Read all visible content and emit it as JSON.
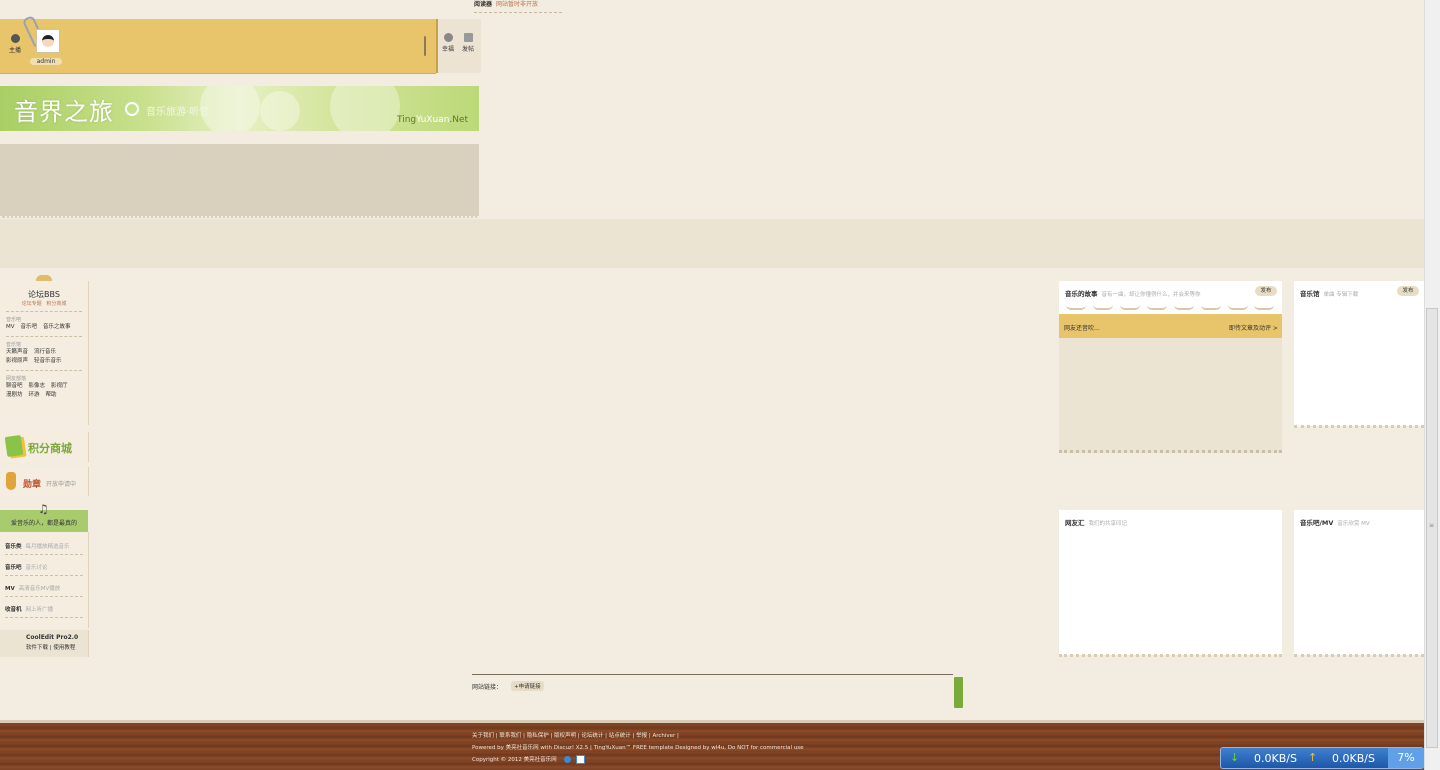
{
  "notice": {
    "label": "阅读器",
    "text": "网站暂时非开放"
  },
  "userbar": {
    "left_btn": "主播",
    "username": "admin",
    "right_btn1": "幸福",
    "right_btn2": "发帖"
  },
  "banner": {
    "title": "音界之旅",
    "subtitle": "音乐旅游·听音",
    "site_prefix": "Ting",
    "site_bold": "YuXuan",
    "site_suffix": ".Net"
  },
  "sidebar": {
    "forum": {
      "title": "论坛BBS",
      "sub1": "论坛专题",
      "sub2": "积分商城",
      "groups": [
        {
          "head": "音乐吧",
          "rows": [
            [
              "MV",
              "音乐吧",
              "音乐之故事"
            ]
          ]
        },
        {
          "head": "音乐馆",
          "rows": [
            [
              "天籁声音",
              "流行音乐"
            ],
            [
              "影视原声",
              "轻音乐音乐"
            ]
          ]
        },
        {
          "head": "网友部落",
          "rows": [
            [
              "聊音吧",
              "影像志",
              "影视厅"
            ],
            [
              "漫剧坊",
              "环游",
              "帮助"
            ]
          ]
        }
      ]
    },
    "shop": {
      "label": "积分商城"
    },
    "medal": {
      "label": "勋章",
      "sub": "开放申请中"
    },
    "music": {
      "title": "爱音乐的人，都是最真的",
      "items": [
        {
          "name": "音乐类",
          "desc": "每月播放精选音乐"
        },
        {
          "name": "音乐吧",
          "desc": "音乐讨论"
        },
        {
          "name": "MV",
          "desc": "高清音乐MV播放"
        },
        {
          "name": "收音机",
          "desc": "网上听广播"
        }
      ]
    },
    "cooledit": {
      "title": "CoolEdit Pro2.0",
      "links": "软件下载 | 使用教程"
    }
  },
  "cards": {
    "story": {
      "title": "音乐的故事",
      "desc": "音有一曲，却让你懂得什么，并会来等你",
      "btn": "发布",
      "band_left": "网友还音吹...",
      "band_right": "即传文章及动评 >"
    },
    "music_hall": {
      "title": "音乐馆",
      "desc": "单曲 专辑下载",
      "btn": "发布"
    },
    "netfriend": {
      "title": "网友汇",
      "desc": "我们的共享印记"
    },
    "mv": {
      "title": "音乐吧/MV",
      "desc": "音乐欣赏 MV"
    }
  },
  "links": {
    "label": "网站链接：",
    "btn": "+申请链接"
  },
  "footer": {
    "line1": "关于我们 | 联系我们 | 隐私保护 | 版权声明 | 论坛统计 | 站点统计 | 举报 | Archiver |",
    "line2": "Powered by 美亮社音乐网 with Discuz! X2.5 | TingYuXuan™ FREE template Designed by wl4u, Do NOT for commercial use",
    "line3": "Copyright © 2012 美亮社音乐网"
  },
  "netspeed": {
    "down": "0.0KB/S",
    "up": "0.0KB/S",
    "cpu": "7%"
  }
}
